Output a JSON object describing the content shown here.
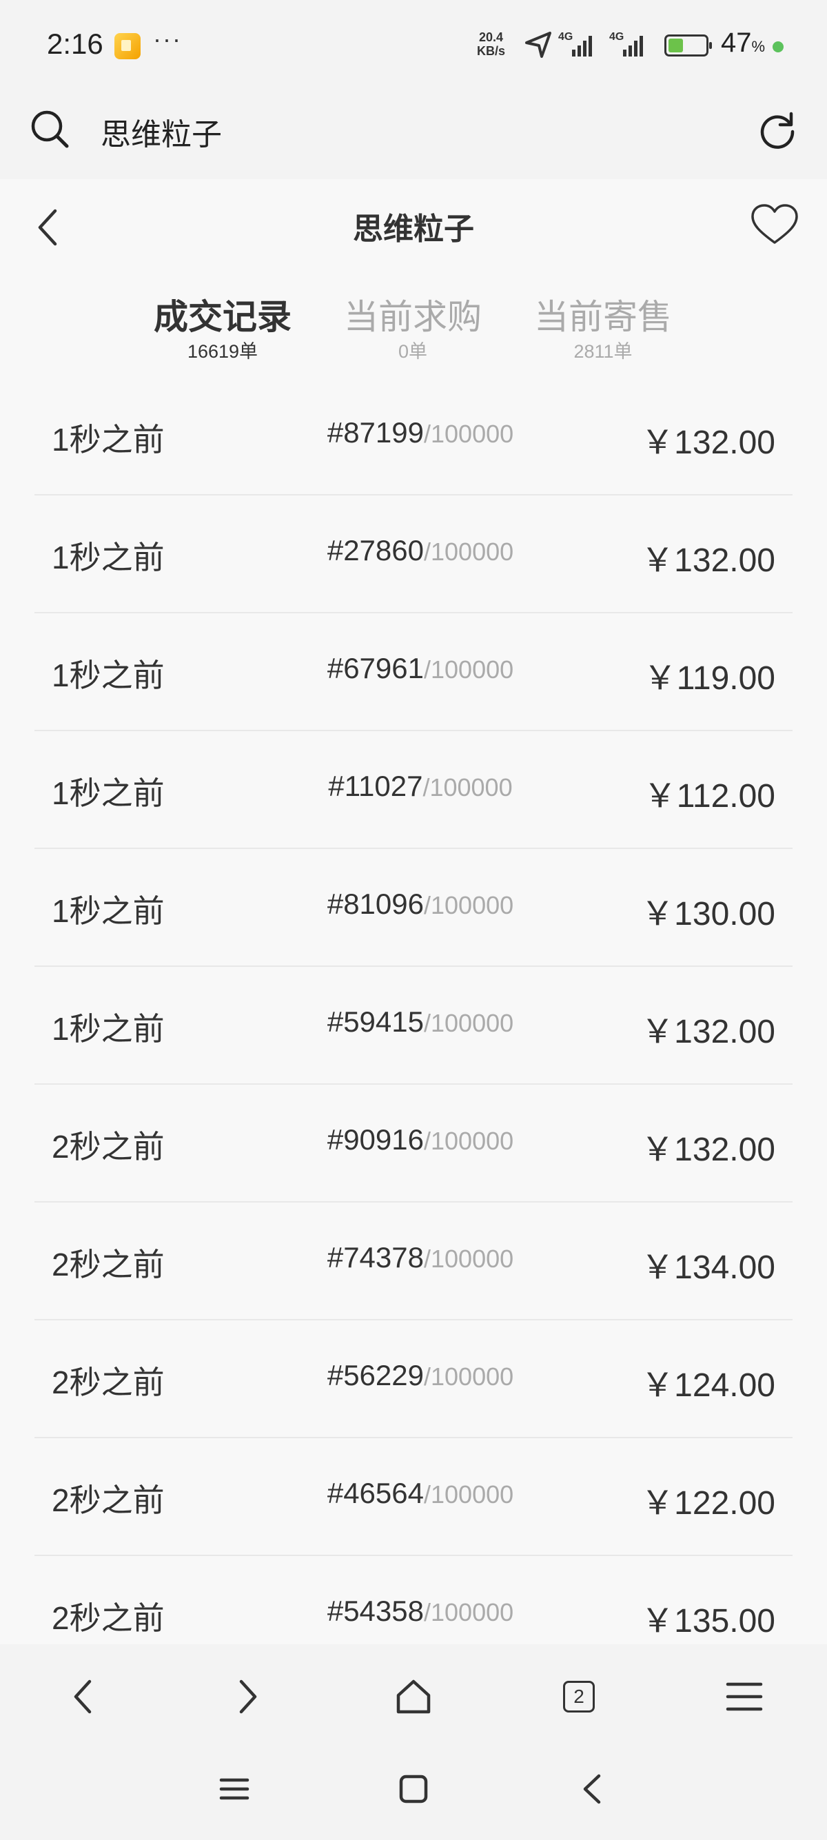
{
  "status_bar": {
    "time": "2:16",
    "more": "···",
    "net_speed": "20.4",
    "net_unit": "KB/s",
    "signal_1": "4G",
    "signal_2": "4G",
    "battery_level": 0.47,
    "battery_text": "47",
    "battery_unit": "%"
  },
  "search": {
    "query": "思维粒子"
  },
  "header": {
    "title": "思维粒子"
  },
  "tabs": [
    {
      "label": "成交记录",
      "count": "16619单",
      "active": true
    },
    {
      "label": "当前求购",
      "count": "0单",
      "active": false
    },
    {
      "label": "当前寄售",
      "count": "2811单",
      "active": false
    }
  ],
  "records": [
    {
      "time": "1秒之前",
      "serial": "#87199",
      "total": "/100000",
      "price": "￥132.00"
    },
    {
      "time": "1秒之前",
      "serial": "#27860",
      "total": "/100000",
      "price": "￥132.00"
    },
    {
      "time": "1秒之前",
      "serial": "#67961",
      "total": "/100000",
      "price": "￥119.00"
    },
    {
      "time": "1秒之前",
      "serial": "#11027",
      "total": "/100000",
      "price": "￥112.00"
    },
    {
      "time": "1秒之前",
      "serial": "#81096",
      "total": "/100000",
      "price": "￥130.00"
    },
    {
      "time": "1秒之前",
      "serial": "#59415",
      "total": "/100000",
      "price": "￥132.00"
    },
    {
      "time": "2秒之前",
      "serial": "#90916",
      "total": "/100000",
      "price": "￥132.00"
    },
    {
      "time": "2秒之前",
      "serial": "#74378",
      "total": "/100000",
      "price": "￥134.00"
    },
    {
      "time": "2秒之前",
      "serial": "#56229",
      "total": "/100000",
      "price": "￥124.00"
    },
    {
      "time": "2秒之前",
      "serial": "#46564",
      "total": "/100000",
      "price": "￥122.00"
    },
    {
      "time": "2秒之前",
      "serial": "#54358",
      "total": "/100000",
      "price": "￥135.00"
    }
  ],
  "toolbar": {
    "tabs_count": "2"
  }
}
